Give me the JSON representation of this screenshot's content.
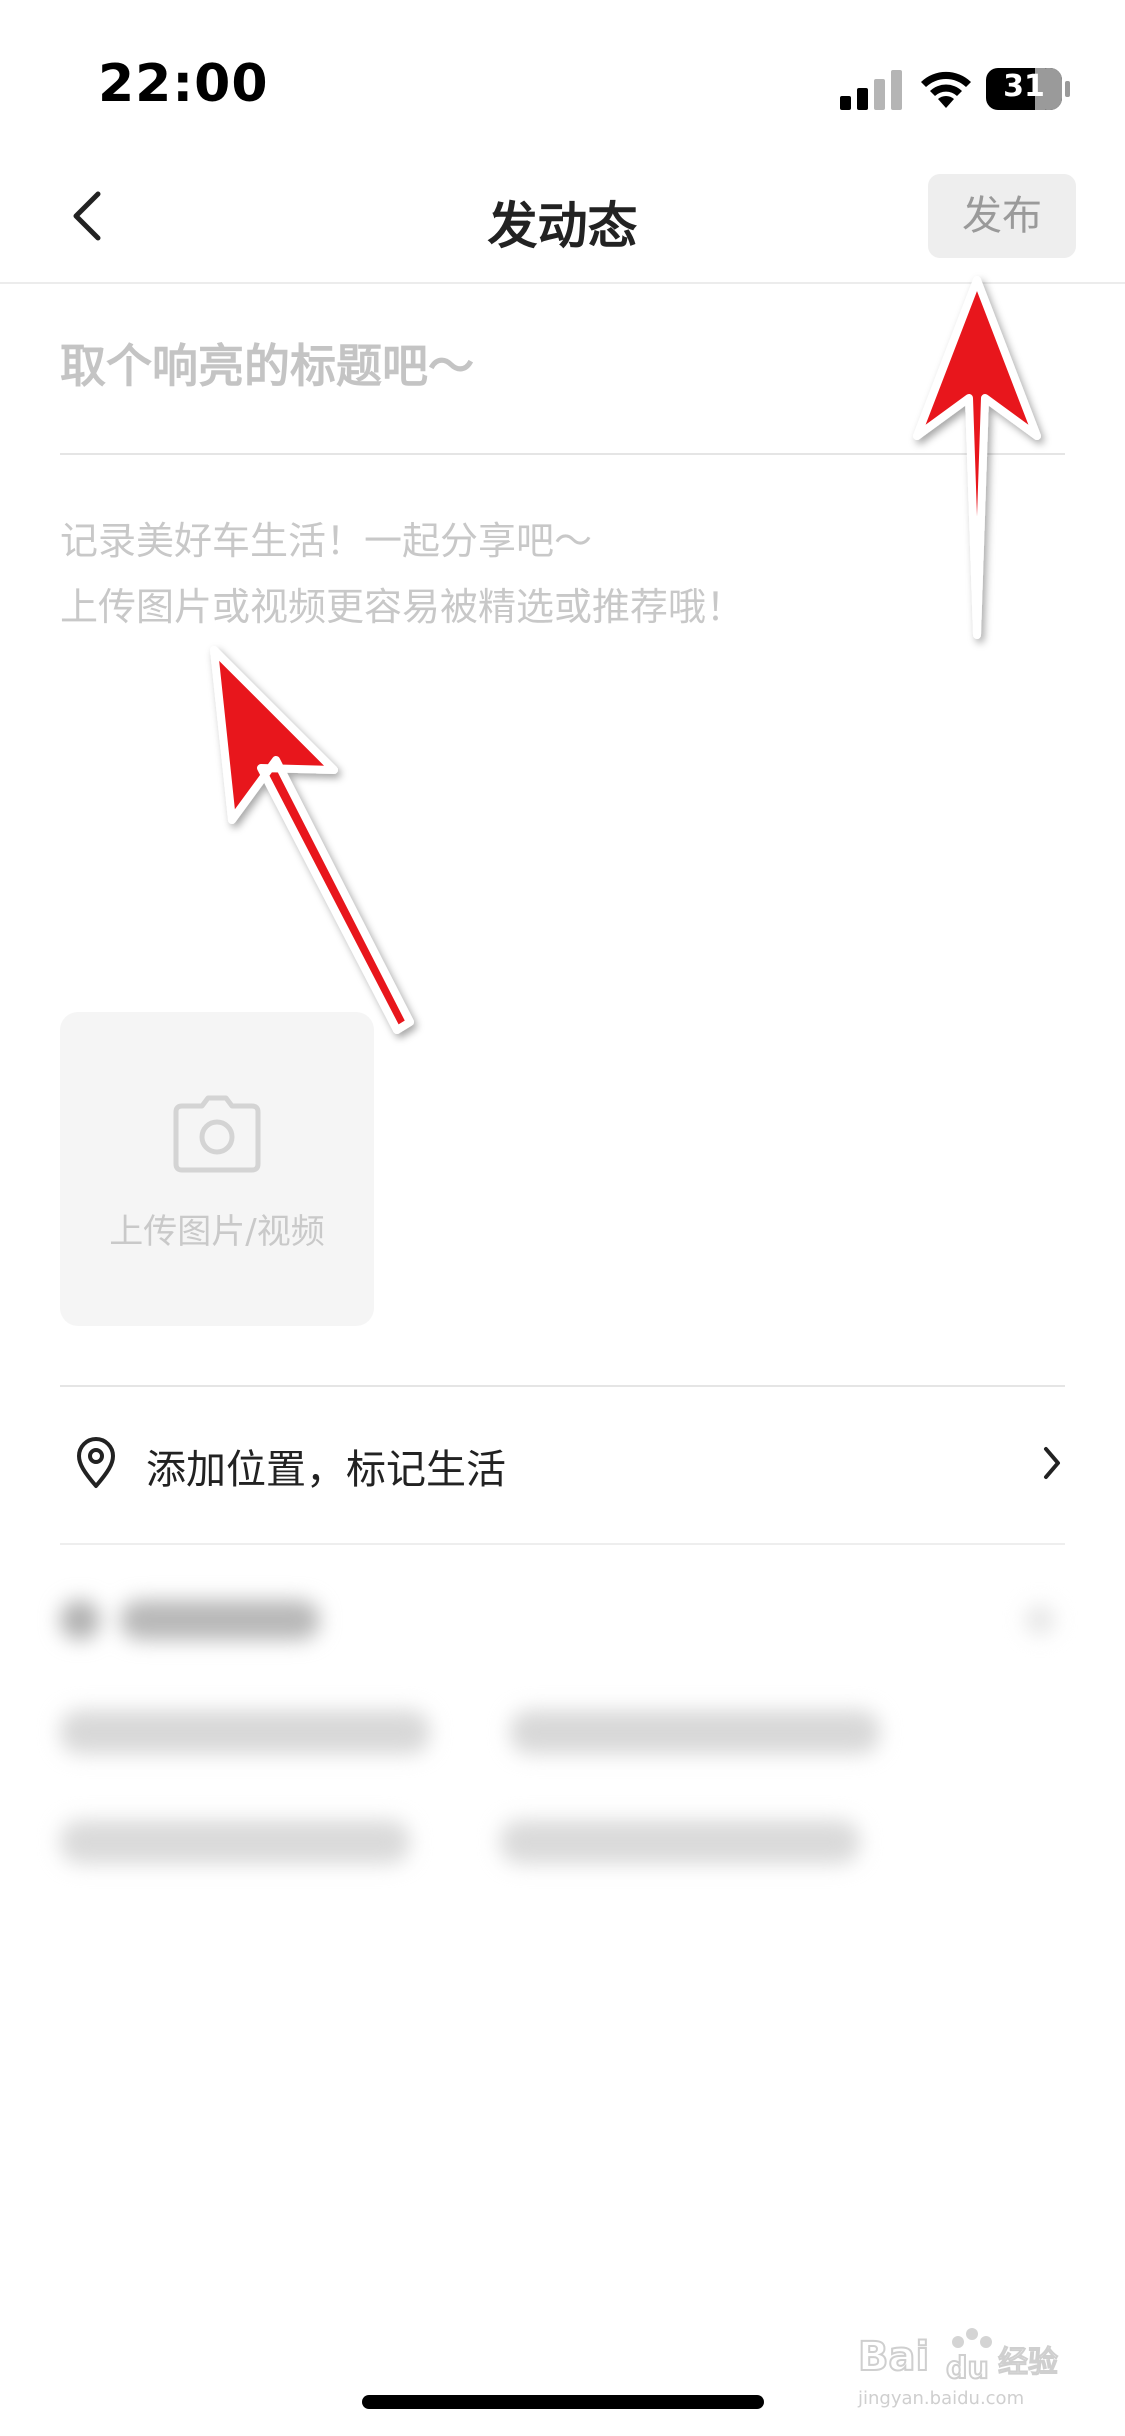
{
  "status_bar": {
    "time": "22:00",
    "battery": "31",
    "signal_icon": "signal-bars-icon",
    "wifi_icon": "wifi-icon",
    "battery_icon": "battery-icon"
  },
  "nav": {
    "back_icon": "chevron-left-icon",
    "title": "发动态",
    "publish_label": "发布"
  },
  "editor": {
    "title_placeholder": "取个响亮的标题吧～",
    "content_placeholder_line1": "记录美好车生活！一起分享吧～",
    "content_placeholder_line2": "上传图片或视频更容易被精选或推荐哦！"
  },
  "upload": {
    "icon": "camera-icon",
    "label": "上传图片/视频"
  },
  "location": {
    "icon": "location-pin-icon",
    "label": "添加位置，标记生活",
    "chevron_icon": "chevron-right-icon"
  },
  "watermark": {
    "brand": "Baidu经验",
    "url": "jingyan.baidu.com"
  },
  "colors": {
    "arrow": "#e8141b",
    "placeholder": "#c4c4c4",
    "publish_bg": "#eeeeee",
    "publish_text": "#9a9a9a"
  }
}
